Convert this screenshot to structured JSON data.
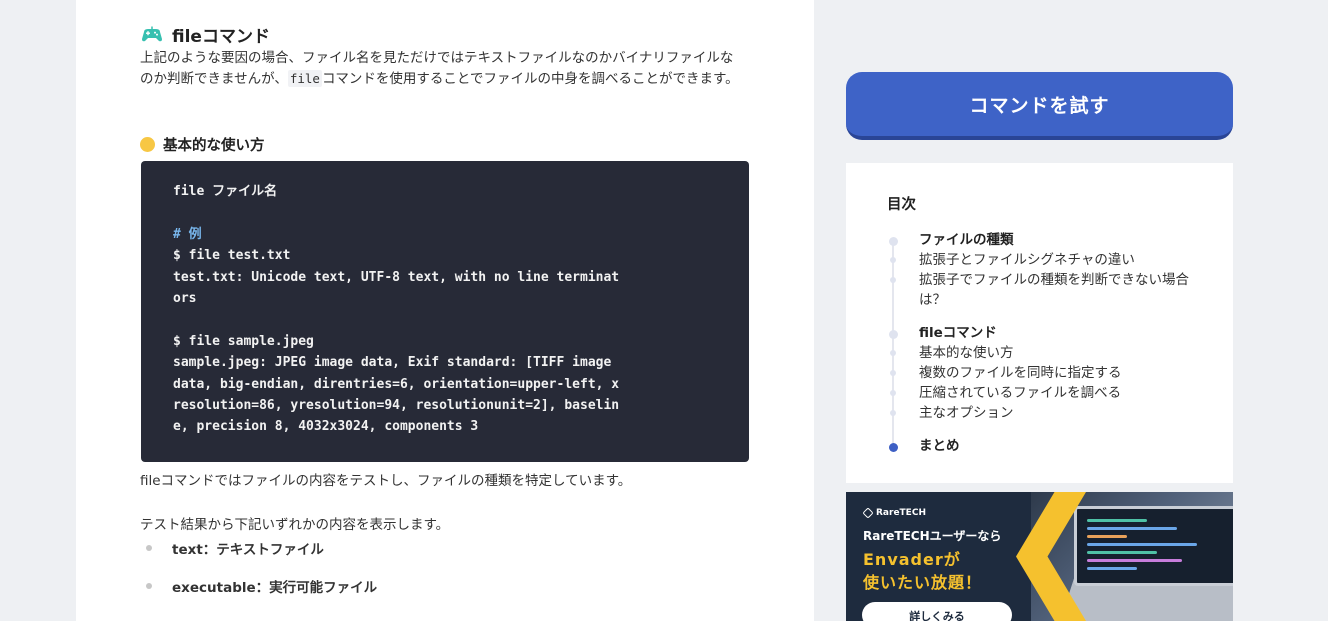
{
  "section": {
    "heading": "fileコマンド",
    "para_part1": "上記のような要因の場合、ファイル名を見ただけではテキストファイルなのかバイナリファイルなのか判断できませんが、",
    "para_code": "file",
    "para_part2": "コマンドを使用することでファイルの中身を調べることができます。"
  },
  "subsection": {
    "heading": "基本的な使い方"
  },
  "code_lines": [
    "file ファイル名",
    "",
    "# 例",
    "$ file test.txt",
    "test.txt: Unicode text, UTF-8 text, with no line terminat",
    "ors",
    "",
    "$ file sample.jpeg",
    "sample.jpeg: JPEG image data, Exif standard: [TIFF image",
    "data, big-endian, direntries=6, orientation=upper-left, x",
    "resolution=86, yresolution=94, resolutionunit=2], baselin",
    "e, precision 8, 4032x3024, components 3"
  ],
  "after_code": "fileコマンドではファイルの内容をテストし、ファイルの種類を特定しています。",
  "result_intro": "テスト結果から下記いずれかの内容を表示します。",
  "bullets": [
    "text：テキストファイル",
    "executable：実行可能ファイル"
  ],
  "try_button": "コマンドを試す",
  "toc": {
    "title": "目次",
    "items": [
      {
        "label": "ファイルの種類",
        "bold": true
      },
      {
        "label": "拡張子とファイルシグネチャの違い",
        "bold": false
      },
      {
        "label": "拡張子でファイルの種類を判断できない場合は？",
        "bold": false
      },
      {
        "label": "fileコマンド",
        "bold": true
      },
      {
        "label": "基本的な使い方",
        "bold": false
      },
      {
        "label": "複数のファイルを同時に指定する",
        "bold": false
      },
      {
        "label": "圧縮されているファイルを調べる",
        "bold": false
      },
      {
        "label": "主なオプション",
        "bold": false
      },
      {
        "label": "まとめ",
        "bold": true
      }
    ]
  },
  "banner": {
    "brand": "RareTECH",
    "sub": "RareTECHユーザーなら",
    "line1": "Envaderが",
    "line2": "使いたい放題！",
    "button": "詳しくみる"
  },
  "colors": {
    "accent_blue": "#3e63c7",
    "code_bg": "#272a37",
    "comment": "#78b6ec",
    "yellow": "#f7c744"
  }
}
